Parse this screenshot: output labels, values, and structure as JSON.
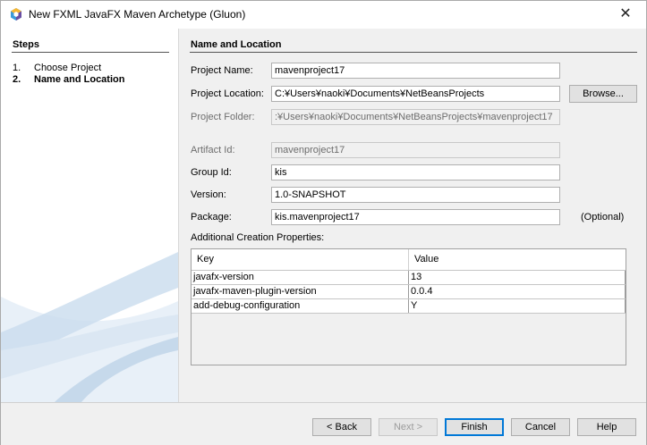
{
  "window": {
    "title": "New FXML JavaFX Maven Archetype (Gluon)",
    "close_glyph": "✕"
  },
  "steps": {
    "title": "Steps",
    "items": [
      {
        "num": "1.",
        "label": "Choose Project"
      },
      {
        "num": "2.",
        "label": "Name and Location"
      }
    ]
  },
  "section": {
    "title": "Name and Location"
  },
  "form": {
    "project_name": {
      "label": "Project Name:",
      "value": "mavenproject17"
    },
    "project_location": {
      "label": "Project Location:",
      "value": "C:¥Users¥naoki¥Documents¥NetBeansProjects",
      "browse": "Browse..."
    },
    "project_folder": {
      "label": "Project Folder:",
      "value": ":¥Users¥naoki¥Documents¥NetBeansProjects¥mavenproject17"
    },
    "artifact_id": {
      "label": "Artifact Id:",
      "value": "mavenproject17"
    },
    "group_id": {
      "label": "Group Id:",
      "value": "kis"
    },
    "version": {
      "label": "Version:",
      "value": "1.0-SNAPSHOT"
    },
    "package": {
      "label": "Package:",
      "value": "kis.mavenproject17",
      "optional": "(Optional)"
    }
  },
  "properties": {
    "label": "Additional Creation Properties:",
    "columns": [
      "Key",
      "Value"
    ],
    "rows": [
      {
        "key": "javafx-version",
        "value": "13"
      },
      {
        "key": "javafx-maven-plugin-version",
        "value": "0.0.4"
      },
      {
        "key": "add-debug-configuration",
        "value": "Y"
      }
    ]
  },
  "footer": {
    "back": "< Back",
    "next": "Next >",
    "finish": "Finish",
    "cancel": "Cancel",
    "help": "Help"
  },
  "colors": {
    "accent": "#0078d7",
    "sidebar_wave": "#c9dcee"
  },
  "icons": {
    "app": "netbeans-cube-icon",
    "close": "close-icon"
  }
}
